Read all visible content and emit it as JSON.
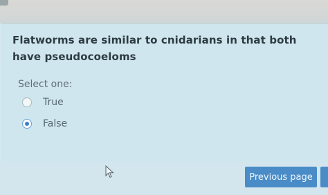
{
  "question": {
    "text": "Flatworms are similar to cnidarians in that both have pseudocoeloms",
    "select_label": "Select one:"
  },
  "options": [
    {
      "label": "True",
      "selected": false
    },
    {
      "label": "False",
      "selected": true
    }
  ],
  "navigation": {
    "previous_label": "Previous page"
  },
  "colors": {
    "question_background": "#cfe6ee",
    "button": "#4a8cc7",
    "radio_selected": "#3a7fd0"
  }
}
